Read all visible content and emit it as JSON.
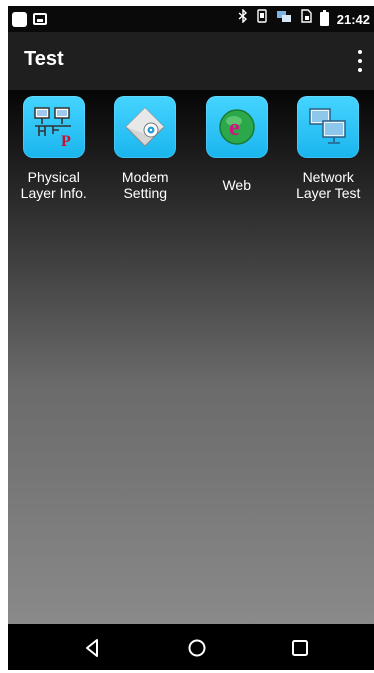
{
  "status_bar": {
    "time": "21:42",
    "left_icons": [
      "notification-square-icon",
      "image-icon"
    ],
    "right_icons": [
      "bluetooth-icon",
      "vibrate-icon",
      "network-icon",
      "sim-icon",
      "battery-icon"
    ]
  },
  "app_bar": {
    "title": "Test",
    "menu_icon": "overflow-menu-icon"
  },
  "apps": [
    {
      "label": "Physical\nLayer Info.",
      "icon": "physical-layer-icon"
    },
    {
      "label": "Modem\nSetting",
      "icon": "modem-icon"
    },
    {
      "label": "Web",
      "icon": "web-icon"
    },
    {
      "label": "Network\nLayer Test",
      "icon": "network-layer-icon"
    }
  ],
  "nav_bar": {
    "buttons": [
      "back-icon",
      "home-icon",
      "recents-icon"
    ]
  },
  "colors": {
    "icon_bg": "#1ab5ee",
    "app_bar": "#1f1f1f",
    "text": "#ffffff"
  }
}
